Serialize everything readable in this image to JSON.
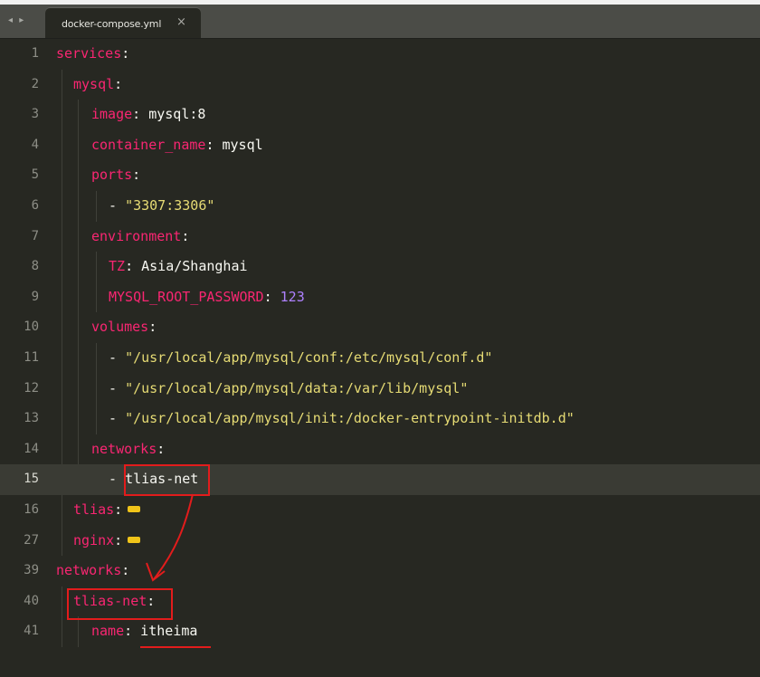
{
  "tab": {
    "nav_arrows": "◂ ▸",
    "filename": "docker-compose.yml",
    "close": "×"
  },
  "colors": {
    "background": "#272822",
    "key": "#f92672",
    "string": "#e6db74",
    "number": "#ae81ff",
    "annotation": "#e21c1c",
    "fold_marker": "#f0c419"
  },
  "lines": [
    {
      "num": "1",
      "key": "services",
      "sep": ":",
      "value": ""
    },
    {
      "num": "2",
      "key": "mysql",
      "sep": ":",
      "value": ""
    },
    {
      "num": "3",
      "key": "image",
      "sep": ":",
      "value": " mysql:8"
    },
    {
      "num": "4",
      "key": "container_name",
      "sep": ":",
      "value": " mysql"
    },
    {
      "num": "5",
      "key": "ports",
      "sep": ":",
      "value": ""
    },
    {
      "num": "6",
      "dash": "- ",
      "value": "\"3307:3306\""
    },
    {
      "num": "7",
      "key": "environment",
      "sep": ":",
      "value": ""
    },
    {
      "num": "8",
      "key": "TZ",
      "sep": ":",
      "value": " Asia/Shanghai"
    },
    {
      "num": "9",
      "key": "MYSQL_ROOT_PASSWORD",
      "sep": ": ",
      "number": "123"
    },
    {
      "num": "10",
      "key": "volumes",
      "sep": ":",
      "value": ""
    },
    {
      "num": "11",
      "dash": "- ",
      "value": "\"/usr/local/app/mysql/conf:/etc/mysql/conf.d\""
    },
    {
      "num": "12",
      "dash": "- ",
      "value": "\"/usr/local/app/mysql/data:/var/lib/mysql\""
    },
    {
      "num": "13",
      "dash": "- ",
      "value": "\"/usr/local/app/mysql/init:/docker-entrypoint-initdb.d\""
    },
    {
      "num": "14",
      "key": "networks",
      "sep": ":",
      "value": ""
    },
    {
      "num": "15",
      "dash": "- ",
      "value": "tlias-net"
    },
    {
      "num": "16",
      "key": "tlias",
      "sep": ":",
      "folded": true
    },
    {
      "num": "27",
      "key": "nginx",
      "sep": ":",
      "folded": true
    },
    {
      "num": "39",
      "key": "networks",
      "sep": ":",
      "value": ""
    },
    {
      "num": "40",
      "key": "tlias-net",
      "sep": ":",
      "value": ""
    },
    {
      "num": "41",
      "key": "name",
      "sep": ":",
      "value": " itheima"
    }
  ],
  "active_line": "15"
}
